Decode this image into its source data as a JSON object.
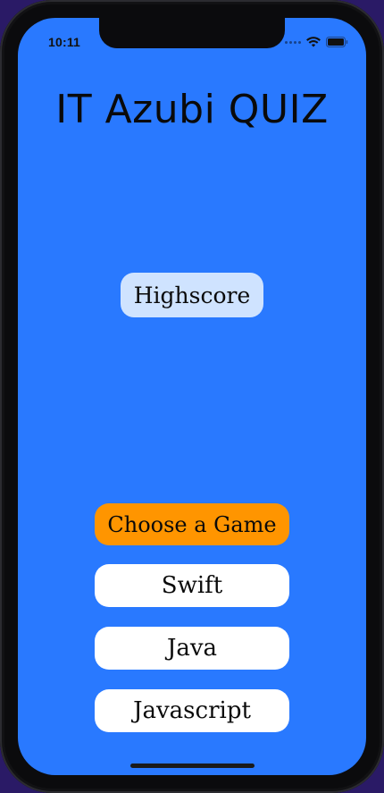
{
  "status_bar": {
    "time": "10:11",
    "icons": [
      "cellular-dots-icon",
      "wifi-icon",
      "battery-icon"
    ]
  },
  "app": {
    "title": "IT Azubi QUIZ",
    "highscore_label": "Highscore",
    "choose_label": "Choose a Game",
    "games": [
      {
        "label": "Swift"
      },
      {
        "label": "Java"
      },
      {
        "label": "Javascript"
      }
    ]
  },
  "colors": {
    "background": "#2979FF",
    "highscore_button": "#CFE3FF",
    "choose_button": "#FF9500",
    "game_button": "#FFFFFF",
    "text": "#0A0A0A"
  }
}
